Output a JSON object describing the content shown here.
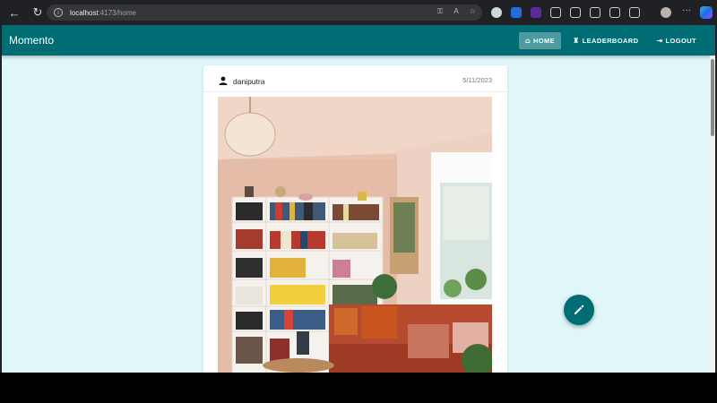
{
  "browser": {
    "url_host": "localhost",
    "url_path": ":4173/home"
  },
  "app": {
    "brand": "Momento",
    "nav": [
      {
        "label": "HOME",
        "icon": "home-icon",
        "active": true
      },
      {
        "label": "LEADERBOARD",
        "icon": "trophy-icon",
        "active": false
      },
      {
        "label": "LOGOUT",
        "icon": "logout-icon",
        "active": false
      }
    ]
  },
  "post": {
    "username": "daniputra",
    "date": "5/11/2023",
    "image": "room-photo"
  },
  "fab": {
    "icon": "pencil-icon"
  },
  "colors": {
    "primary": "#006d74",
    "page_bg": "#e0f7fa",
    "active_nav": "#4f9a9f"
  }
}
